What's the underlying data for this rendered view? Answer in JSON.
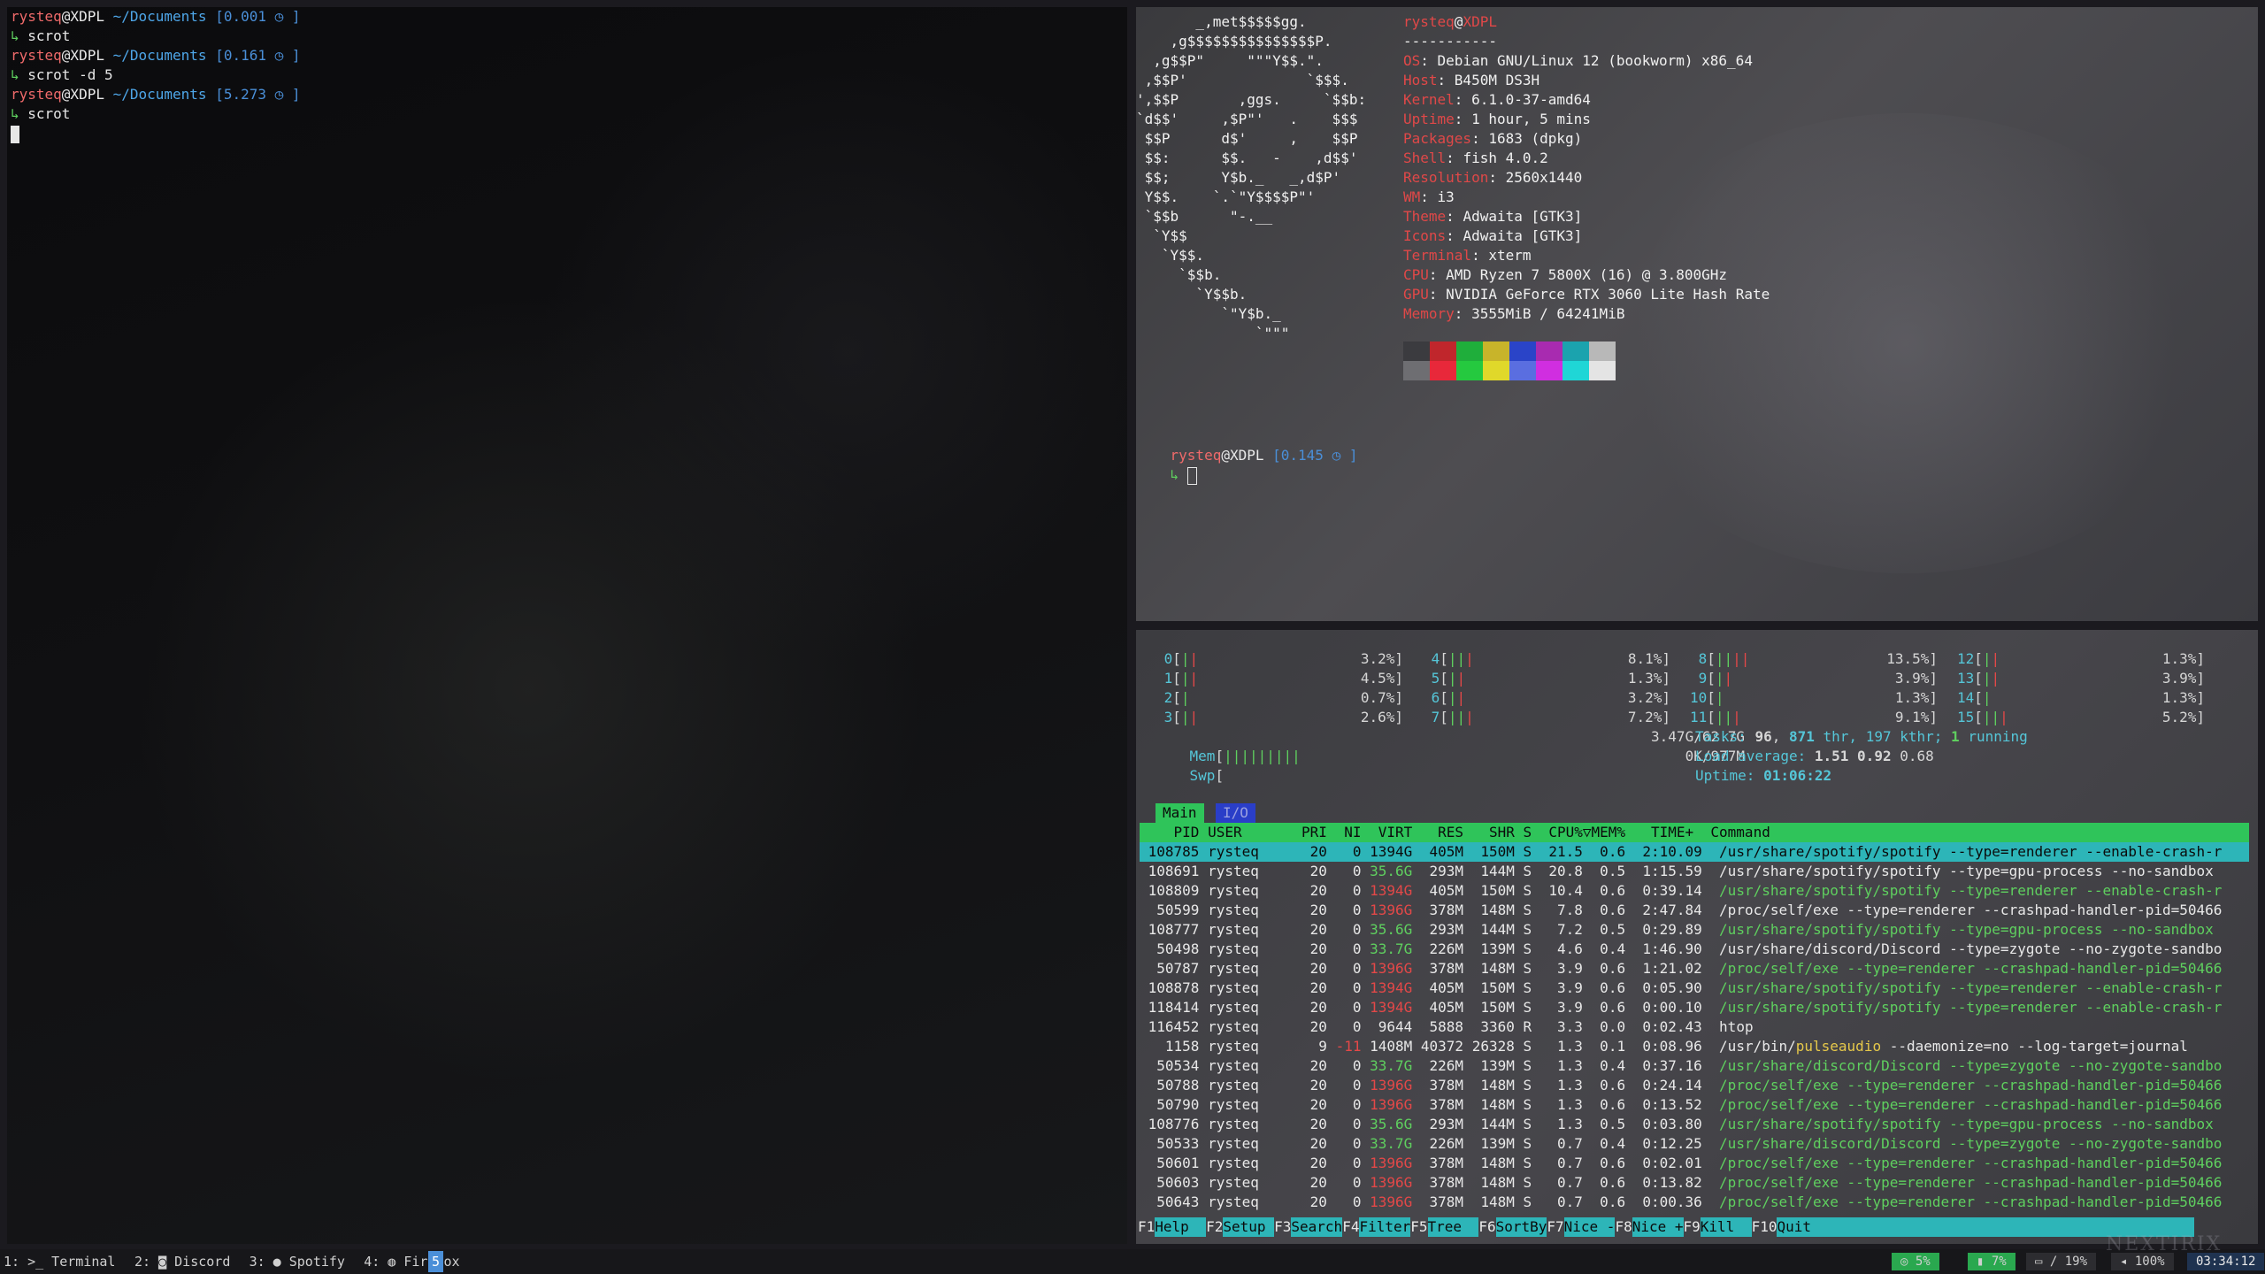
{
  "left_terminal": {
    "prompts": [
      {
        "user": "rysteq",
        "host": "XDPL",
        "path": "~/Documents",
        "time": "[0.001 ◷ ]",
        "cmd": "scrot"
      },
      {
        "user": "rysteq",
        "host": "XDPL",
        "path": "~/Documents",
        "time": "[0.161 ◷ ]",
        "cmd": "scrot -d 5"
      },
      {
        "user": "rysteq",
        "host": "XDPL",
        "path": "~/Documents",
        "time": "[5.273 ◷ ]",
        "cmd": "scrot"
      }
    ],
    "arrow": "↳"
  },
  "neofetch": {
    "logo": [
      "       _,met$$$$$gg.",
      "    ,g$$$$$$$$$$$$$$$P.",
      "  ,g$$P\"     \"\"\"Y$$.\".",
      " ,$$P'              `$$$.",
      "',$$P       ,ggs.     `$$b:",
      "`d$$'     ,$P\"'   .    $$$",
      " $$P      d$'     ,    $$P",
      " $$:      $$.   -    ,d$$'",
      " $$;      Y$b._   _,d$P'",
      " Y$$.    `.`\"Y$$$$P\"'",
      " `$$b      \"-.__",
      "  `Y$$",
      "   `Y$$.",
      "     `$$b.",
      "       `Y$$b.",
      "          `\"Y$b._",
      "              `\"\"\""
    ],
    "title_user": "rysteq",
    "title_host": "XDPL",
    "separator": "-----------",
    "fields": [
      {
        "k": "OS",
        "v": "Debian GNU/Linux 12 (bookworm) x86_64"
      },
      {
        "k": "Host",
        "v": "B450M DS3H"
      },
      {
        "k": "Kernel",
        "v": "6.1.0-37-amd64"
      },
      {
        "k": "Uptime",
        "v": "1 hour, 5 mins"
      },
      {
        "k": "Packages",
        "v": "1683 (dpkg)"
      },
      {
        "k": "Shell",
        "v": "fish 4.0.2"
      },
      {
        "k": "Resolution",
        "v": "2560x1440"
      },
      {
        "k": "WM",
        "v": "i3"
      },
      {
        "k": "Theme",
        "v": "Adwaita [GTK3]"
      },
      {
        "k": "Icons",
        "v": "Adwaita [GTK3]"
      },
      {
        "k": "Terminal",
        "v": "xterm"
      },
      {
        "k": "CPU",
        "v": "AMD Ryzen 7 5800X (16) @ 3.800GHz"
      },
      {
        "k": "GPU",
        "v": "NVIDIA GeForce RTX 3060 Lite Hash Rate"
      },
      {
        "k": "Memory",
        "v": "3555MiB / 64241MiB"
      }
    ],
    "palette_top": [
      "#3b3b3f",
      "#c0262c",
      "#1fae3b",
      "#c8b42a",
      "#2a44c8",
      "#a82bb0",
      "#1ba3ae",
      "#b8b8b8"
    ],
    "palette_bottom": [
      "#6e6e72",
      "#e8283a",
      "#25c93f",
      "#e0d82a",
      "#5a6ee0",
      "#d02ee0",
      "#1fd6d6",
      "#e4e4e4"
    ],
    "prompt": {
      "user": "rysteq",
      "host": "XDPL",
      "time": "[0.145 ◷ ]"
    },
    "arrow": "↳"
  },
  "htop": {
    "cpus": [
      {
        "id": " 0",
        "bar": "||",
        "pct": "3.2%"
      },
      {
        "id": " 1",
        "bar": "||",
        "pct": "4.5%"
      },
      {
        "id": " 2",
        "bar": "|",
        "pct": "0.7%"
      },
      {
        "id": " 3",
        "bar": "||",
        "pct": "2.6%"
      },
      {
        "id": "4",
        "bar": "|||",
        "pct": "8.1%"
      },
      {
        "id": "5",
        "bar": "||",
        "pct": "1.3%"
      },
      {
        "id": "6",
        "bar": "||",
        "pct": "3.2%"
      },
      {
        "id": "7",
        "bar": "|||",
        "pct": "7.2%"
      },
      {
        "id": "8",
        "bar": "||||",
        "pct": "13.5%"
      },
      {
        "id": "9",
        "bar": "||",
        "pct": "3.9%"
      },
      {
        "id": "10",
        "bar": "|",
        "pct": "1.3%"
      },
      {
        "id": "11",
        "bar": "|||",
        "pct": "9.1%"
      },
      {
        "id": "12",
        "bar": "||",
        "pct": "1.3%"
      },
      {
        "id": "13",
        "bar": "||",
        "pct": "3.9%"
      },
      {
        "id": "14",
        "bar": "|",
        "pct": "1.3%"
      },
      {
        "id": "15",
        "bar": "|||",
        "pct": "5.2%"
      }
    ],
    "mem_label": "Mem",
    "mem_bar": "|||||||||",
    "mem_value": "3.47G/62.7G",
    "swp_label": "Swp",
    "swp_value": "0K/977M",
    "tasks_label": "Tasks:",
    "tasks": "96",
    "thr": "871",
    "thr_label": "thr,",
    "kthr": "197 kthr;",
    "running": "1",
    "running_label": "running",
    "load_label": "Load average:",
    "load1": "1.51",
    "load5": "0.92",
    "load15": "0.68",
    "uptime_label": "Uptime:",
    "uptime": "01:06:22",
    "tab_main": "Main",
    "tab_io": "I/O",
    "header": "    PID USER       PRI  NI  VIRT   RES   SHR S  CPU%▽MEM%   TIME+  Command",
    "processes": [
      {
        "pid": "108785",
        "user": "rysteq",
        "pri": "20",
        "ni": "0",
        "virt": "1394G",
        "res": "405M",
        "shr": "150M",
        "s": "S",
        "cpu": "21.5",
        "mem": "0.6",
        "time": "2:10.09",
        "cmd": "/usr/share/spotify/spotify --type=renderer --enable-crash-r",
        "sel": true,
        "thread": true
      },
      {
        "pid": "108691",
        "user": "rysteq",
        "pri": "20",
        "ni": "0",
        "virt": "35.6G",
        "res": "293M",
        "shr": "144M",
        "s": "S",
        "cpu": "20.8",
        "mem": "0.5",
        "time": "1:15.59",
        "cmd": "/usr/share/spotify/spotify --type=gpu-process --no-sandbox",
        "sel": false,
        "thread": false
      },
      {
        "pid": "108809",
        "user": "rysteq",
        "pri": "20",
        "ni": "0",
        "virt": "1394G",
        "res": "405M",
        "shr": "150M",
        "s": "S",
        "cpu": "10.4",
        "mem": "0.6",
        "time": "0:39.14",
        "cmd": "/usr/share/spotify/spotify --type=renderer --enable-crash-r",
        "sel": false,
        "thread": true
      },
      {
        "pid": "50599",
        "user": "rysteq",
        "pri": "20",
        "ni": "0",
        "virt": "1396G",
        "res": "378M",
        "shr": "148M",
        "s": "S",
        "cpu": "7.8",
        "mem": "0.6",
        "time": "2:47.84",
        "cmd": "/proc/self/exe --type=renderer --crashpad-handler-pid=50466",
        "sel": false,
        "thread": false
      },
      {
        "pid": "108777",
        "user": "rysteq",
        "pri": "20",
        "ni": "0",
        "virt": "35.6G",
        "res": "293M",
        "shr": "144M",
        "s": "S",
        "cpu": "7.2",
        "mem": "0.5",
        "time": "0:29.89",
        "cmd": "/usr/share/spotify/spotify --type=gpu-process --no-sandbox",
        "sel": false,
        "thread": true
      },
      {
        "pid": "50498",
        "user": "rysteq",
        "pri": "20",
        "ni": "0",
        "virt": "33.7G",
        "res": "226M",
        "shr": "139M",
        "s": "S",
        "cpu": "4.6",
        "mem": "0.4",
        "time": "1:46.90",
        "cmd": "/usr/share/discord/Discord --type=zygote --no-zygote-sandbo",
        "sel": false,
        "thread": false
      },
      {
        "pid": "50787",
        "user": "rysteq",
        "pri": "20",
        "ni": "0",
        "virt": "1396G",
        "res": "378M",
        "shr": "148M",
        "s": "S",
        "cpu": "3.9",
        "mem": "0.6",
        "time": "1:21.02",
        "cmd": "/proc/self/exe --type=renderer --crashpad-handler-pid=50466",
        "sel": false,
        "thread": true
      },
      {
        "pid": "108878",
        "user": "rysteq",
        "pri": "20",
        "ni": "0",
        "virt": "1394G",
        "res": "405M",
        "shr": "150M",
        "s": "S",
        "cpu": "3.9",
        "mem": "0.6",
        "time": "0:05.90",
        "cmd": "/usr/share/spotify/spotify --type=renderer --enable-crash-r",
        "sel": false,
        "thread": true
      },
      {
        "pid": "118414",
        "user": "rysteq",
        "pri": "20",
        "ni": "0",
        "virt": "1394G",
        "res": "405M",
        "shr": "150M",
        "s": "S",
        "cpu": "3.9",
        "mem": "0.6",
        "time": "0:00.10",
        "cmd": "/usr/share/spotify/spotify --type=renderer --enable-crash-r",
        "sel": false,
        "thread": true
      },
      {
        "pid": "116452",
        "user": "rysteq",
        "pri": "20",
        "ni": "0",
        "virt": "9644",
        "res": "5888",
        "shr": "3360",
        "s": "R",
        "cpu": "3.3",
        "mem": "0.0",
        "time": "0:02.43",
        "cmd": "htop",
        "sel": false,
        "thread": false
      },
      {
        "pid": "1158",
        "user": "rysteq",
        "pri": "9",
        "ni": "-11",
        "virt": "1408M",
        "res": "40372",
        "shr": "26328",
        "s": "S",
        "cpu": "1.3",
        "mem": "0.1",
        "time": "0:08.96",
        "cmd": "/usr/bin/pulseaudio --daemonize=no --log-target=journal",
        "sel": false,
        "thread": false,
        "pulse": true
      },
      {
        "pid": "50534",
        "user": "rysteq",
        "pri": "20",
        "ni": "0",
        "virt": "33.7G",
        "res": "226M",
        "shr": "139M",
        "s": "S",
        "cpu": "1.3",
        "mem": "0.4",
        "time": "0:37.16",
        "cmd": "/usr/share/discord/Discord --type=zygote --no-zygote-sandbo",
        "sel": false,
        "thread": true
      },
      {
        "pid": "50788",
        "user": "rysteq",
        "pri": "20",
        "ni": "0",
        "virt": "1396G",
        "res": "378M",
        "shr": "148M",
        "s": "S",
        "cpu": "1.3",
        "mem": "0.6",
        "time": "0:24.14",
        "cmd": "/proc/self/exe --type=renderer --crashpad-handler-pid=50466",
        "sel": false,
        "thread": true
      },
      {
        "pid": "50790",
        "user": "rysteq",
        "pri": "20",
        "ni": "0",
        "virt": "1396G",
        "res": "378M",
        "shr": "148M",
        "s": "S",
        "cpu": "1.3",
        "mem": "0.6",
        "time": "0:13.52",
        "cmd": "/proc/self/exe --type=renderer --crashpad-handler-pid=50466",
        "sel": false,
        "thread": true
      },
      {
        "pid": "108776",
        "user": "rysteq",
        "pri": "20",
        "ni": "0",
        "virt": "35.6G",
        "res": "293M",
        "shr": "144M",
        "s": "S",
        "cpu": "1.3",
        "mem": "0.5",
        "time": "0:03.80",
        "cmd": "/usr/share/spotify/spotify --type=gpu-process --no-sandbox",
        "sel": false,
        "thread": true
      },
      {
        "pid": "50533",
        "user": "rysteq",
        "pri": "20",
        "ni": "0",
        "virt": "33.7G",
        "res": "226M",
        "shr": "139M",
        "s": "S",
        "cpu": "0.7",
        "mem": "0.4",
        "time": "0:12.25",
        "cmd": "/usr/share/discord/Discord --type=zygote --no-zygote-sandbo",
        "sel": false,
        "thread": true
      },
      {
        "pid": "50601",
        "user": "rysteq",
        "pri": "20",
        "ni": "0",
        "virt": "1396G",
        "res": "378M",
        "shr": "148M",
        "s": "S",
        "cpu": "0.7",
        "mem": "0.6",
        "time": "0:02.01",
        "cmd": "/proc/self/exe --type=renderer --crashpad-handler-pid=50466",
        "sel": false,
        "thread": true
      },
      {
        "pid": "50603",
        "user": "rysteq",
        "pri": "20",
        "ni": "0",
        "virt": "1396G",
        "res": "378M",
        "shr": "148M",
        "s": "S",
        "cpu": "0.7",
        "mem": "0.6",
        "time": "0:13.82",
        "cmd": "/proc/self/exe --type=renderer --crashpad-handler-pid=50466",
        "sel": false,
        "thread": true
      },
      {
        "pid": "50643",
        "user": "rysteq",
        "pri": "20",
        "ni": "0",
        "virt": "1396G",
        "res": "378M",
        "shr": "148M",
        "s": "S",
        "cpu": "0.7",
        "mem": "0.6",
        "time": "0:00.36",
        "cmd": "/proc/self/exe --type=renderer --crashpad-handler-pid=50466",
        "sel": false,
        "thread": true
      }
    ],
    "fkeys": [
      {
        "k": "F1",
        "l": "Help  "
      },
      {
        "k": "F2",
        "l": "Setup "
      },
      {
        "k": "F3",
        "l": "Search"
      },
      {
        "k": "F4",
        "l": "Filter"
      },
      {
        "k": "F5",
        "l": "Tree  "
      },
      {
        "k": "F6",
        "l": "SortBy"
      },
      {
        "k": "F7",
        "l": "Nice -"
      },
      {
        "k": "F8",
        "l": "Nice +"
      },
      {
        "k": "F9",
        "l": "Kill  "
      },
      {
        "k": "F10",
        "l": "Quit                                             "
      }
    ]
  },
  "statusbar": {
    "workspaces": [
      {
        "num": "1:",
        "icon": ">_",
        "label": "Terminal"
      },
      {
        "num": "2:",
        "icon": "◙",
        "label": "Discord"
      },
      {
        "num": "3:",
        "icon": "●",
        "label": "Spotify"
      },
      {
        "num": "4:",
        "icon": "◍",
        "label": "Firefox"
      }
    ],
    "active_workspace": "5",
    "stats": [
      {
        "icon": "◎",
        "value": "5%",
        "color": "#2aa84f"
      },
      {
        "icon": "▮",
        "value": "7%",
        "color": "#2aa84f"
      },
      {
        "icon": "▭",
        "value": "/ 19%",
        "color": "#2c2c30"
      },
      {
        "icon": "◂",
        "value": "100%",
        "color": "#2c2c30"
      }
    ],
    "clock": "03:34:12",
    "watermark": "NEXTIRIX"
  }
}
